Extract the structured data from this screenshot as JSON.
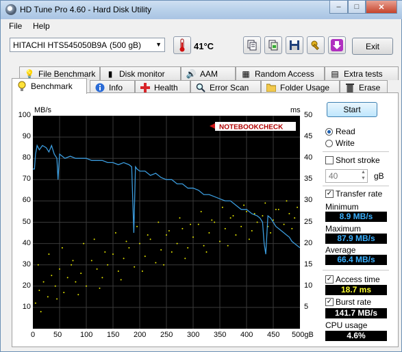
{
  "window": {
    "title": "HD Tune Pro 4.60 - Hard Disk Utility"
  },
  "menu": {
    "file": "File",
    "help": "Help"
  },
  "toolbar": {
    "drive_model": "HITACHI HTS545050B9A",
    "drive_size": "(500 gB)",
    "temperature": "41°C",
    "exit_label": "Exit"
  },
  "tabs_row1": [
    "File Benchmark",
    "Disk monitor",
    "AAM",
    "Random Access",
    "Extra tests"
  ],
  "tabs_row2": [
    "Benchmark",
    "Info",
    "Health",
    "Error Scan",
    "Folder Usage",
    "Erase"
  ],
  "controls": {
    "start_label": "Start",
    "read_label": "Read",
    "write_label": "Write",
    "short_stroke_label": "Short stroke",
    "short_stroke_value": "40",
    "short_stroke_unit": "gB",
    "transfer_rate_label": "Transfer rate",
    "access_time_label": "Access time",
    "burst_rate_label": "Burst rate",
    "cpu_usage_label": "CPU usage"
  },
  "results": {
    "minimum_label": "Minimum",
    "minimum": "8.9 MB/s",
    "maximum_label": "Maximum",
    "maximum": "87.9 MB/s",
    "average_label": "Average",
    "average": "66.4 MB/s",
    "access_time": "18.7 ms",
    "burst_rate": "141.7 MB/s",
    "cpu_usage": "4.6%"
  },
  "colors": {
    "transfer": "#3b9cde",
    "access": "#e6e600",
    "min_max_avg": "#3ab0ff",
    "access_text": "#ffff30",
    "white_text": "#ffffff"
  },
  "chart_data": {
    "type": "line",
    "watermark": "NOTEBOOKCHECK",
    "y_left_unit": "MB/s",
    "y_right_unit": "ms",
    "ylim_left": [
      0,
      100
    ],
    "ylim_right": [
      0,
      50
    ],
    "y_left_ticks": [
      "100",
      "90",
      "80",
      "70",
      "60",
      "50",
      "40",
      "30",
      "20",
      "10"
    ],
    "y_right_ticks": [
      "50",
      "45",
      "40",
      "35",
      "30",
      "25",
      "20",
      "15",
      "10",
      "5"
    ],
    "x_ticks": [
      "0",
      "50",
      "100",
      "150",
      "200",
      "250",
      "300",
      "350",
      "400",
      "450",
      "500gB"
    ],
    "xlim": [
      0,
      500
    ],
    "grid": true,
    "series": [
      {
        "x": [
          0,
          3,
          5,
          8,
          12,
          18,
          25,
          30,
          35,
          40,
          45,
          47,
          50,
          55,
          60,
          70,
          80,
          90,
          100,
          110,
          120,
          130,
          140,
          150,
          160,
          170,
          180,
          185,
          189,
          192,
          195,
          200,
          210,
          220,
          230,
          240,
          250,
          260,
          270,
          280,
          290,
          300,
          310,
          320,
          330,
          340,
          350,
          360,
          370,
          380,
          390,
          400,
          410,
          420,
          425,
          430,
          433,
          436,
          440,
          445,
          450,
          455,
          460,
          465,
          470,
          475,
          480,
          485,
          490,
          495,
          500
        ],
        "y": [
          75,
          75,
          82,
          86,
          84,
          86,
          85,
          83,
          86,
          82,
          80,
          70,
          82,
          81,
          80,
          81,
          80,
          80,
          80,
          79,
          79,
          79,
          78,
          78,
          77,
          78,
          77,
          76,
          45,
          76,
          75,
          74,
          74,
          72,
          73,
          71,
          70,
          70,
          68,
          68,
          66,
          66,
          65,
          63,
          63,
          62,
          61,
          60,
          60,
          58,
          56,
          56,
          54,
          53,
          52,
          50,
          40,
          35,
          53,
          52,
          50,
          48,
          47,
          46,
          45,
          44,
          43,
          41,
          40,
          39,
          38
        ]
      },
      {
        "x": [
          5,
          12,
          20,
          28,
          35,
          42,
          50,
          58,
          65,
          72,
          80,
          90,
          100,
          110,
          120,
          130,
          140,
          150,
          160,
          170,
          180,
          190,
          200,
          210,
          220,
          230,
          240,
          250,
          260,
          270,
          280,
          290,
          300,
          310,
          320,
          330,
          340,
          350,
          360,
          370,
          380,
          390,
          400,
          410,
          420,
          430,
          440,
          450,
          460,
          470,
          480,
          490,
          10,
          30,
          55,
          75,
          95,
          115,
          135,
          155,
          175,
          195,
          215,
          235,
          255,
          275,
          295,
          315,
          335,
          355,
          375,
          395,
          415,
          435,
          455,
          475,
          495,
          15,
          45,
          85,
          125,
          165,
          205,
          245,
          285,
          325,
          365,
          405,
          445,
          485
        ],
        "y": [
          12,
          18,
          22,
          15,
          25,
          20,
          28,
          17,
          24,
          30,
          22,
          26,
          20,
          32,
          28,
          24,
          30,
          35,
          27,
          33,
          38,
          29,
          40,
          34,
          42,
          31,
          37,
          44,
          36,
          40,
          47,
          38,
          43,
          49,
          39,
          45,
          50,
          41,
          47,
          52,
          44,
          48,
          55,
          46,
          50,
          53,
          48,
          51,
          56,
          49,
          54,
          52,
          30,
          35,
          38,
          32,
          40,
          42,
          36,
          45,
          41,
          48,
          44,
          50,
          46,
          52,
          49,
          55,
          51,
          57,
          53,
          58,
          54,
          59,
          56,
          60,
          57,
          8,
          14,
          16,
          19,
          23,
          27,
          30,
          33,
          36,
          39,
          42,
          45,
          47
        ]
      }
    ]
  }
}
